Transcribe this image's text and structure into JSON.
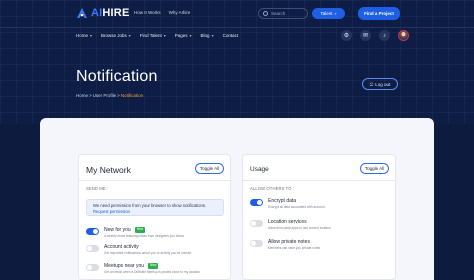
{
  "brand": {
    "name_prefix": "AI",
    "name_suffix": "HIRE"
  },
  "topnav": {
    "links": [
      "How It Works",
      "Why AIhire"
    ]
  },
  "search": {
    "placeholder": "Search"
  },
  "talent_select": {
    "value": "Talent"
  },
  "post_project": {
    "label": "Find a Project"
  },
  "mainnav": {
    "items": [
      "Home",
      "Browse Jobs",
      "Find Talent",
      "Pages",
      "Blog",
      "Contact"
    ]
  },
  "header": {
    "title": "Notification",
    "breadcrumb": [
      "Home",
      ">",
      "User Profile",
      ">",
      "Notification"
    ],
    "logout_label": "Log out"
  },
  "my_network": {
    "title": "My Network",
    "toggle_all": "Toggle All",
    "section": "SEND ME :",
    "permission": {
      "text": "We need permission from your browser to show notifications.",
      "link": "Request permission"
    },
    "settings": [
      {
        "label": "New for you",
        "badge": "New",
        "desc": "A weekly email featuring shots from designers you follow",
        "on": true
      },
      {
        "label": "Account activity",
        "desc": "Get important notifications about you or activity you've missed",
        "on": false
      },
      {
        "label": "Meetups near you",
        "badge": "New",
        "desc": "Get an email when a Dribbble Meetup is posted close to my location",
        "on": false
      }
    ]
  },
  "usage": {
    "title": "Usage",
    "toggle_all": "Toggle All",
    "section": "ALLOW OTHERS TO :",
    "settings": [
      {
        "label": "Encrypt data",
        "desc": "Encrypt all data associated with account",
        "on": true
      },
      {
        "label": "Location services",
        "desc": "Allow third party apps to use current location",
        "on": false
      },
      {
        "label": "Allow private notes",
        "desc": "Members can save you private notes",
        "on": false
      }
    ]
  },
  "colors": {
    "accent": "#1f5fe6",
    "hero_bg": "#0d1d45",
    "breadcrumb_current": "#f0a531",
    "badge_new": "#2fae4e"
  }
}
